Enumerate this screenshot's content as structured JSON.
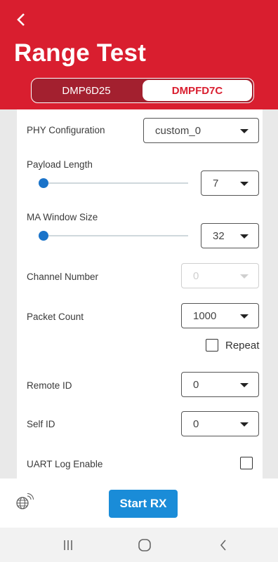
{
  "header": {
    "title": "Range Test",
    "tabs": [
      {
        "label": "DMP6D25",
        "active": false
      },
      {
        "label": "DMPFD7C",
        "active": true
      }
    ]
  },
  "form": {
    "phy_configuration": {
      "label": "PHY Configuration",
      "value": "custom_0"
    },
    "payload_length": {
      "label": "Payload Length",
      "value": "7",
      "slider_fraction": 0.03
    },
    "ma_window_size": {
      "label": "MA Window Size",
      "value": "32",
      "slider_fraction": 0.03
    },
    "channel_number": {
      "label": "Channel Number",
      "value": "0",
      "disabled": true
    },
    "packet_count": {
      "label": "Packet Count",
      "value": "1000"
    },
    "repeat": {
      "label": "Repeat",
      "checked": false
    },
    "remote_id": {
      "label": "Remote ID",
      "value": "0"
    },
    "self_id": {
      "label": "Self ID",
      "value": "0"
    },
    "uart_log_enable": {
      "label": "UART Log Enable",
      "checked": false
    }
  },
  "bottom": {
    "start_label": "Start RX",
    "icon": "globe-signal-icon"
  },
  "colors": {
    "brand_red": "#d91e2f",
    "accent_blue": "#1a8cd8"
  },
  "navbar": {
    "icons": [
      "recent-apps-icon",
      "home-icon",
      "back-icon"
    ]
  }
}
